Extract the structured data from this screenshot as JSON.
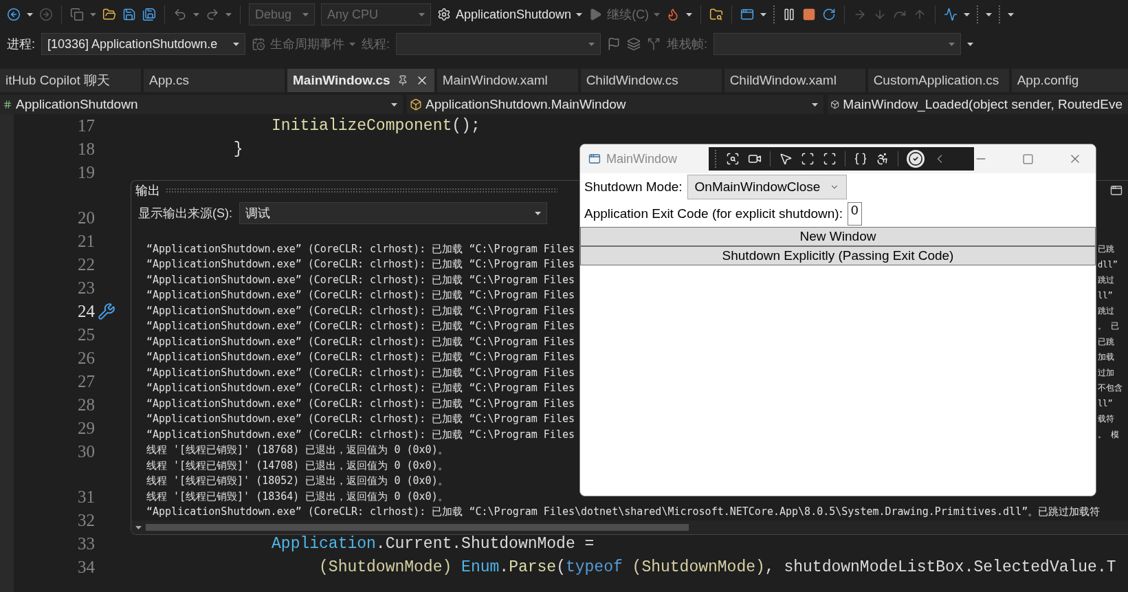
{
  "toolbar": {
    "configuration": {
      "value": "Debug",
      "disabled": true
    },
    "platform": {
      "value": "Any CPU",
      "disabled": true
    },
    "startup_project": "ApplicationShutdown",
    "continue_button": {
      "label": "继续(C)",
      "disabled": true
    }
  },
  "debug_location": {
    "process_label": "进程:",
    "process": "[10336] ApplicationShutdown.e",
    "lifecycle_events": {
      "label": "生命周期事件",
      "disabled": true
    },
    "thread_label": "线程:",
    "stack_frame_label": "堆栈帧:"
  },
  "tabs": [
    {
      "label": "itHub Copilot 聊天",
      "selected": false
    },
    {
      "label": "App.cs",
      "selected": false
    },
    {
      "label": "MainWindow.cs",
      "selected": true
    },
    {
      "label": "MainWindow.xaml",
      "selected": false
    },
    {
      "label": "ChildWindow.cs",
      "selected": false
    },
    {
      "label": "ChildWindow.xaml",
      "selected": false
    },
    {
      "label": "CustomApplication.cs",
      "selected": false
    },
    {
      "label": "App.config",
      "selected": false
    }
  ],
  "navigation_bar": {
    "project": "ApplicationShutdown",
    "type": "ApplicationShutdown.MainWindow",
    "member": "MainWindow_Loaded(object sender, RoutedEve"
  },
  "editor": {
    "lines": [
      {
        "kind": "line",
        "number": "17",
        "current": false,
        "tokens": [
          {
            "kind": "method",
            "text": "               InitializeComponent"
          },
          {
            "kind": "plain",
            "text": "();"
          }
        ]
      },
      {
        "kind": "line",
        "number": "18",
        "current": false,
        "tokens": [
          {
            "kind": "plain",
            "text": "           }"
          }
        ]
      },
      {
        "kind": "line",
        "number": "19",
        "current": false
      },
      {
        "kind": "code-lens"
      },
      {
        "kind": "line",
        "number": "20",
        "current": false
      },
      {
        "kind": "line",
        "number": "21",
        "current": false
      },
      {
        "kind": "line",
        "number": "22",
        "current": false
      },
      {
        "kind": "line",
        "number": "23",
        "current": false
      },
      {
        "kind": "line",
        "number": "24",
        "current": true
      },
      {
        "kind": "line",
        "number": "25",
        "current": false
      },
      {
        "kind": "line",
        "number": "26",
        "current": false
      },
      {
        "kind": "line",
        "number": "27",
        "current": false
      },
      {
        "kind": "line",
        "number": "28",
        "current": false
      },
      {
        "kind": "line",
        "number": "29",
        "current": false
      },
      {
        "kind": "line",
        "number": "30",
        "current": false
      },
      {
        "kind": "code-lens"
      },
      {
        "kind": "line",
        "number": "31",
        "current": false
      },
      {
        "kind": "line",
        "number": "32",
        "current": false
      },
      {
        "kind": "line",
        "number": "33",
        "current": false,
        "tokens": [
          {
            "kind": "type",
            "text": "               Application"
          },
          {
            "kind": "plain",
            "text": ".Current.ShutdownMode ="
          }
        ]
      },
      {
        "kind": "line",
        "number": "34",
        "current": false,
        "tokens": [
          {
            "kind": "cast",
            "text": "                    (ShutdownMode) "
          },
          {
            "kind": "type",
            "text": "Enum"
          },
          {
            "kind": "plain",
            "text": "."
          },
          {
            "kind": "method",
            "text": "Parse"
          },
          {
            "kind": "plain",
            "text": "("
          },
          {
            "kind": "keyword",
            "text": "typeof"
          },
          {
            "kind": "cast",
            "text": " (ShutdownMode)"
          },
          {
            "kind": "plain",
            "text": ", shutdownModeListBox.SelectedValue.T"
          }
        ]
      }
    ]
  },
  "output_panel": {
    "title": "输出",
    "source_label": "显示输出来源(S):",
    "source": "调试",
    "lines": [
      {
        "text": "“ApplicationShutdown.exe” (CoreCLR: clrhost): 已加载 “C:\\Program Files",
        "tail": "已跳"
      },
      {
        "text": "“ApplicationShutdown.exe” (CoreCLR: clrhost): 已加载 “C:\\Program Files",
        "tail": "dll”"
      },
      {
        "text": "“ApplicationShutdown.exe” (CoreCLR: clrhost): 已加载 “C:\\Program Files",
        "tail": "跳过"
      },
      {
        "text": "“ApplicationShutdown.exe” (CoreCLR: clrhost): 已加载 “C:\\Program Files",
        "tail": "ll”"
      },
      {
        "text": "“ApplicationShutdown.exe” (CoreCLR: clrhost): 已加载 “C:\\Program Files",
        "tail": "跳过"
      },
      {
        "text": "“ApplicationShutdown.exe” (CoreCLR: clrhost): 已加载 “C:\\Program Files",
        "tail": "。 已"
      },
      {
        "text": "“ApplicationShutdown.exe” (CoreCLR: clrhost): 已加载 “C:\\Program Files",
        "tail": "已跳"
      },
      {
        "text": "“ApplicationShutdown.exe” (CoreCLR: clrhost): 已加载 “C:\\Program Files",
        "tail": "加载"
      },
      {
        "text": "“ApplicationShutdown.exe” (CoreCLR: clrhost): 已加载 “C:\\Program Files",
        "tail": "过加"
      },
      {
        "text": "“ApplicationShutdown.exe” (CoreCLR: clrhost): 已加载 “C:\\Program Files",
        "tail": "不包含"
      },
      {
        "text": "“ApplicationShutdown.exe” (CoreCLR: clrhost): 已加载 “C:\\Program Files",
        "tail": "ll”"
      },
      {
        "text": "“ApplicationShutdown.exe” (CoreCLR: clrhost): 已加载 “C:\\Program Files",
        "tail": "载符"
      },
      {
        "text": "“ApplicationShutdown.exe” (CoreCLR: clrhost): 已加载 “C:\\Program Files",
        "tail": "。 模"
      },
      {
        "text": "线程 '[线程已销毁]' (18768) 已退出，返回值为 0 (0x0)。"
      },
      {
        "text": "线程 '[线程已销毁]' (14708) 已退出，返回值为 0 (0x0)。"
      },
      {
        "text": "线程 '[线程已销毁]' (18052) 已退出，返回值为 0 (0x0)。"
      },
      {
        "text": "线程 '[线程已销毁]' (18364) 已退出，返回值为 0 (0x0)。"
      },
      {
        "text": "“ApplicationShutdown.exe” (CoreCLR: clrhost): 已加载 “C:\\Program Files\\dotnet\\shared\\Microsoft.NETCore.App\\8.0.5\\System.Drawing.Primitives.dll”。已跳过加载符"
      }
    ]
  },
  "main_window": {
    "title": "MainWindow",
    "shutdown_mode_label": "Shutdown Mode:",
    "shutdown_mode": "OnMainWindowClose",
    "exit_code_label": "Application Exit Code (for explicit shutdown):",
    "exit_code": "0",
    "buttons": [
      "New Window",
      "Shutdown Explicitly (Passing Exit Code)"
    ]
  }
}
